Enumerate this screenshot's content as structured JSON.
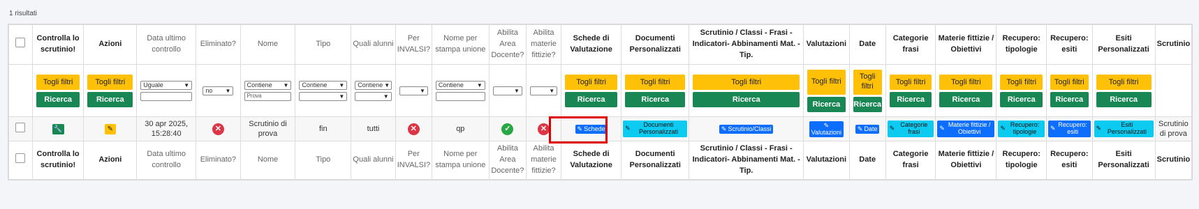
{
  "result_count": "1 risultati",
  "columns": [
    {
      "label": "",
      "muted": false
    },
    {
      "label": "Controlla lo scrutinio!",
      "muted": false
    },
    {
      "label": "Azioni",
      "muted": false
    },
    {
      "label": "Data ultimo controllo",
      "muted": true
    },
    {
      "label": "Eliminato?",
      "muted": true
    },
    {
      "label": "Nome",
      "muted": true
    },
    {
      "label": "Tipo",
      "muted": true
    },
    {
      "label": "Quali alunni",
      "muted": true
    },
    {
      "label": "Per INVALSI?",
      "muted": true
    },
    {
      "label": "Nome per stampa unione",
      "muted": true
    },
    {
      "label": "Abilita Area Docente?",
      "muted": true
    },
    {
      "label": "Abilita materie fittizie?",
      "muted": true
    },
    {
      "label": "Schede di Valutazione",
      "muted": false
    },
    {
      "label": "Documenti Personalizzati",
      "muted": false
    },
    {
      "label": "Scrutinio / Classi - Frasi - Indicatori- Abbinamenti Mat. - Tip.",
      "muted": false
    },
    {
      "label": "Valutazioni",
      "muted": false
    },
    {
      "label": "Date",
      "muted": false
    },
    {
      "label": "Categorie frasi",
      "muted": false
    },
    {
      "label": "Materie fittizie / Obiettivi",
      "muted": false
    },
    {
      "label": "Recupero: tipologie",
      "muted": false
    },
    {
      "label": "Recupero: esiti",
      "muted": false
    },
    {
      "label": "Esiti Personalizzati",
      "muted": false
    },
    {
      "label": "Scrutinio",
      "muted": false
    }
  ],
  "filters": {
    "toggle_label": "Togli filtri",
    "search_label": "Ricerca",
    "toggle_label_wrapped": "Togli\nfiltri",
    "data_select": "Uguale",
    "eliminato_select": "no",
    "nome_select": "Contiene",
    "nome_input": "Prova",
    "tipo_select": "Contiene",
    "alunni_select": "Contiene",
    "stampa_select": "Contiene"
  },
  "row": {
    "data_ultimo_controllo": "30 apr 2025, 15:28:40",
    "nome": "Scrutinio di prova",
    "tipo": "fin",
    "quali_alunni": "tutti",
    "nome_stampa_unione": "qp",
    "scrutinio": "Scrutinio di prova",
    "buttons": {
      "schede": "Schede",
      "documenti": "Documenti Personalizzati",
      "scrutinio_classi": "Scrutinio/Classi",
      "valutazioni": "Valutazioni",
      "date": "Date",
      "categorie": "Categorie frasi",
      "materie": "Materie fittizie / Obiettivi",
      "recupero_tipologie": "Recupero: tipologie",
      "recupero_esiti": "Recupero: esiti",
      "esiti_personalizzati": "Esiti Personalizzati"
    }
  },
  "colors": {
    "yellow": "#ffc107",
    "green": "#198754",
    "blue": "#0d6efd",
    "cyan": "#0dcaf0",
    "red": "#dc3545",
    "highlight": "#e00000"
  },
  "icons": [
    "wrench-icon",
    "edit-icon",
    "x-circle-icon",
    "check-circle-icon",
    "chevron-down-icon"
  ]
}
